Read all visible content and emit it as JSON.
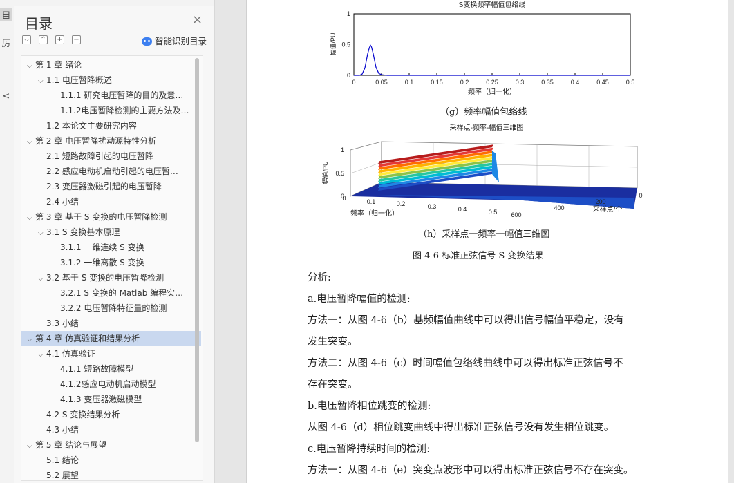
{
  "rail": {
    "items": [
      "目",
      "厉",
      "<"
    ]
  },
  "toc": {
    "title": "目录",
    "close_glyph": "×",
    "toolbar": {
      "collapse": "⌵",
      "expand": "⌃",
      "add": "+",
      "remove": "−"
    },
    "smart_label": "智能识别目录",
    "items": [
      {
        "text": "第 1 章  绪论",
        "level": 1,
        "expanded": true,
        "selected": false
      },
      {
        "text": "1.1  电压暂降概述",
        "level": 2,
        "expanded": true,
        "selected": false
      },
      {
        "text": "1.1.1  研究电压暂降的目的及意…",
        "level": 3,
        "selected": false
      },
      {
        "text": "1.1.2电压暂降检测的主要方法及…",
        "level": 3,
        "selected": false
      },
      {
        "text": "1.2  本论文主要研究内容",
        "level": 2,
        "selected": false
      },
      {
        "text": "第 2 章  电压暂降扰动源特性分析",
        "level": 1,
        "expanded": true,
        "selected": false
      },
      {
        "text": "2.1  短路故障引起的电压暂降",
        "level": 2,
        "selected": false
      },
      {
        "text": "2.2  感应电动机启动引起的电压暂…",
        "level": 2,
        "selected": false
      },
      {
        "text": "2.3  变压器激磁引起的电压暂降",
        "level": 2,
        "selected": false
      },
      {
        "text": "2.4  小结",
        "level": 2,
        "selected": false
      },
      {
        "text": "第 3 章  基于 S 变换的电压暂降检测",
        "level": 1,
        "expanded": true,
        "selected": false
      },
      {
        "text": "3.1  S 变换基本原理",
        "level": 2,
        "expanded": true,
        "selected": false
      },
      {
        "text": "3.1.1  一维连续 S 变换",
        "level": 3,
        "selected": false
      },
      {
        "text": "3.1.2  一维离散 S 变换",
        "level": 3,
        "selected": false
      },
      {
        "text": "3.2  基于 S 变换的电压暂降检测",
        "level": 2,
        "expanded": true,
        "selected": false
      },
      {
        "text": "3.2.1  S 变换的 Matlab 编程实…",
        "level": 3,
        "selected": false
      },
      {
        "text": "3.2.2  电压暂降特征量的检测",
        "level": 3,
        "selected": false
      },
      {
        "text": "3.3  小结",
        "level": 2,
        "selected": false
      },
      {
        "text": "第 4 章  仿真验证和结果分析",
        "level": 1,
        "expanded": true,
        "selected": true
      },
      {
        "text": "4.1  仿真验证",
        "level": 2,
        "expanded": true,
        "selected": false
      },
      {
        "text": "4.1.1  短路故障模型",
        "level": 3,
        "selected": false
      },
      {
        "text": "4.1.2感应电动机启动模型",
        "level": 3,
        "selected": false
      },
      {
        "text": "4.1.3  变压器激磁模型",
        "level": 3,
        "selected": false
      },
      {
        "text": "4.2  S 变换结果分析",
        "level": 2,
        "selected": false
      },
      {
        "text": "4.3  小结",
        "level": 2,
        "selected": false
      },
      {
        "text": "第 5 章  结论与展望",
        "level": 1,
        "expanded": true,
        "selected": false
      },
      {
        "text": "5.1  结论",
        "level": 2,
        "selected": false
      },
      {
        "text": "5.2  展望",
        "level": 2,
        "selected": false
      }
    ]
  },
  "document": {
    "chart_g": {
      "title": "S变换频率幅值包络线",
      "caption": "（g）频率幅值包络线"
    },
    "chart_h": {
      "title": "采样点-频率-幅值三维图",
      "caption": "（h）采样点一频率一幅值三维图"
    },
    "figure_caption": "图 4-6   标准正弦信号 S 变换结果",
    "paragraphs": [
      "分析:",
      "a.电压暂降幅值的检测:",
      "方法一：从图 4-6（b）基频幅值曲线中可以得出信号幅值平稳定，没有",
      "发生突变。",
      "方法二：从图 4-6（c）时间幅值包络线曲线中可以得出标准正弦信号不",
      "存在突变。",
      "b.电压暂降相位跳变的检测:",
      "从图 4-6（d）相位跳变曲线中得出标准正弦信号没有发生相位跳变。",
      "c.电压暂降持续时间的检测:",
      "方法一：从图 4-6（e）突变点波形中可以得出标准正弦信号不存在突变。"
    ]
  },
  "chart_data": [
    {
      "type": "line",
      "title": "S变换频率幅值包络线",
      "xlabel": "频率（归一化）",
      "ylabel": "幅值/PU",
      "xlim": [
        0,
        0.5
      ],
      "ylim": [
        0,
        1
      ],
      "xticks": [
        "0",
        "0.05",
        "0.1",
        "0.15",
        "0.2",
        "0.25",
        "0.3",
        "0.35",
        "0.4",
        "0.45",
        "0.5"
      ],
      "yticks": [
        "0",
        "0.5",
        "1"
      ],
      "color": "#0000cc",
      "x": [
        0,
        0.01,
        0.015,
        0.02,
        0.025,
        0.028,
        0.03,
        0.032,
        0.035,
        0.04,
        0.045,
        0.05,
        0.06,
        0.1,
        0.2,
        0.3,
        0.4,
        0.5
      ],
      "y": [
        0,
        0,
        0.02,
        0.12,
        0.35,
        0.45,
        0.49,
        0.46,
        0.35,
        0.13,
        0.03,
        0.01,
        0,
        0,
        0,
        0,
        0,
        0
      ]
    },
    {
      "type": "surface",
      "title": "采样点-频率-幅值三维图",
      "xlabel": "频率（归一化）",
      "ylabel": "采样点/个",
      "zlabel": "幅值/PU",
      "xticks": [
        "0",
        "0.1",
        "0.2",
        "0.3",
        "0.4",
        "0.5"
      ],
      "yticks": [
        "0",
        "200",
        "400",
        "600"
      ],
      "zticks": [
        "0",
        "0.5",
        "1"
      ],
      "peak_frequency": 0.03,
      "peak_amplitude": 1
    }
  ]
}
